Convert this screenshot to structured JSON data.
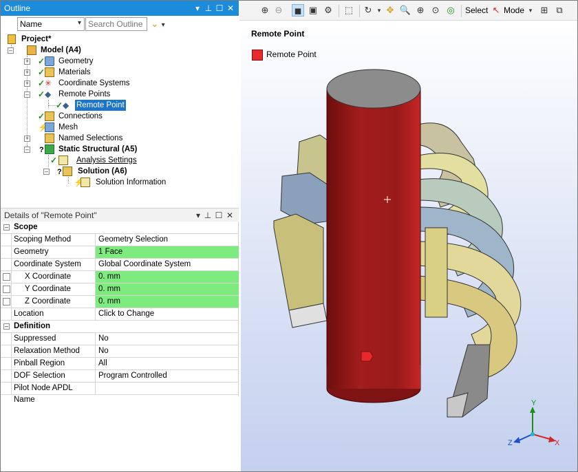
{
  "outline": {
    "title": "Outline",
    "filter_select": "Name",
    "search_placeholder": "Search Outline",
    "tree": {
      "project": "Project*",
      "model": "Model (A4)",
      "geometry": "Geometry",
      "materials": "Materials",
      "coordinate_systems": "Coordinate Systems",
      "remote_points": "Remote Points",
      "remote_point": "Remote Point",
      "connections": "Connections",
      "mesh": "Mesh",
      "named_selections": "Named Selections",
      "static_structural": "Static Structural (A5)",
      "analysis_settings": "Analysis Settings",
      "solution": "Solution (A6)",
      "solution_information": "Solution Information"
    }
  },
  "details": {
    "title": "Details of \"Remote Point\"",
    "sections": {
      "scope": "Scope",
      "definition": "Definition"
    },
    "rows": {
      "scoping_method": {
        "k": "Scoping Method",
        "v": "Geometry Selection"
      },
      "geometry": {
        "k": "Geometry",
        "v": "1 Face"
      },
      "coordinate_system": {
        "k": "Coordinate System",
        "v": "Global Coordinate System"
      },
      "x_coordinate": {
        "k": "X Coordinate",
        "v": "0. mm"
      },
      "y_coordinate": {
        "k": "Y Coordinate",
        "v": "0. mm"
      },
      "z_coordinate": {
        "k": "Z Coordinate",
        "v": "0. mm"
      },
      "location": {
        "k": "Location",
        "v": "Click to Change"
      },
      "suppressed": {
        "k": "Suppressed",
        "v": "No"
      },
      "relaxation_method": {
        "k": "Relaxation Method",
        "v": "No"
      },
      "pinball_region": {
        "k": "Pinball Region",
        "v": "All"
      },
      "dof_selection": {
        "k": "DOF Selection",
        "v": "Program Controlled"
      },
      "pilot_node": {
        "k": "Pilot Node APDL Name",
        "v": ""
      }
    }
  },
  "toolbar": {
    "select_label": "Select",
    "mode_label": "Mode"
  },
  "viewport": {
    "title": "Remote Point",
    "legend_label": "Remote Point",
    "legend_color": "#e8292b",
    "triad": {
      "x": "X",
      "y": "Y",
      "z": "Z"
    }
  },
  "colors": {
    "title_bar": "#1c8bd9",
    "selected": "#1c75c9",
    "green_cell": "#7eeb7e",
    "cylinder": "#9d1c1c"
  }
}
